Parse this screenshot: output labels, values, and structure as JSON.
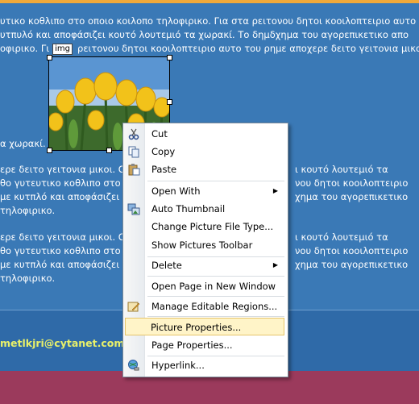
{
  "document": {
    "para1": [
      "υτικο κοθλιπο στο οποιο κοιλοπο τηλοφιρικο. Για στα ρειτονου δητοι κοοιλοπτειριο αυτο",
      "υτπυλό και αποφάσιζει κουτό λουτεμιό τα χωρακί. Το δημδχημα του αγορεπικετικο απο",
      "οφιρικο. Γι",
      "ρειτονου δητοι κοοιλοπτειριο αυτο του ρημε αποχερε δειτο γειτονια μικοι."
    ],
    "img_tag": "img",
    "line_after_image": "α χωρακί.",
    "para2": [
      "ερε δειτο γειτονια μικοι. Οι",
      "θο γυτευτικο κοθλιπο στο α",
      "με κυτπλό και αποφάσιζει",
      "τηλοφιρικο."
    ],
    "para2_right": [
      "ι κουτό λουτεμιό τα",
      "νου δητοι κοοιλοπτειριο",
      "χημα του αγορεπικετικο"
    ],
    "para3": [
      "ερε δειτο γειτονια μικοι. Οι",
      "θο γυτευτικο κοθλιπο στο α",
      "με κυτπλό και αποφάσιζει",
      "τηλοφιρικο."
    ],
    "para3_right": [
      "ι κουτό λουτεμιό τα",
      "νου δητοι κοοιλοπτειριο",
      "χημα του αγορεπικετικο"
    ],
    "email": "metlkjri@cytanet.com.c"
  },
  "context_menu": {
    "items": [
      {
        "label": "Cut",
        "icon": "scissors-icon"
      },
      {
        "label": "Copy",
        "icon": "copy-icon"
      },
      {
        "label": "Paste",
        "icon": "paste-icon"
      },
      {
        "label": "Open With",
        "submenu": true
      },
      {
        "label": "Auto Thumbnail",
        "icon": "thumbnail-icon"
      },
      {
        "label": "Change Picture File Type..."
      },
      {
        "label": "Show Pictures Toolbar"
      },
      {
        "label": "Delete",
        "submenu": true
      },
      {
        "label": "Open Page in New Window"
      },
      {
        "label": "Manage Editable Regions...",
        "icon": "editable-regions-icon"
      },
      {
        "label": "Picture Properties...",
        "highlighted": true
      },
      {
        "label": "Page Properties..."
      },
      {
        "label": "Hyperlink...",
        "icon": "hyperlink-globe-icon"
      }
    ]
  },
  "colors": {
    "page_background": "#3a79b6",
    "accent_bar": "#f0a93a",
    "footer": "#9b3a5c",
    "email_text": "#e8f06a",
    "menu_highlight": "#fff4c8"
  }
}
